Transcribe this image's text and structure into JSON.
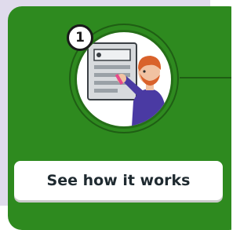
{
  "step": {
    "number": "1"
  },
  "illustration": {
    "icon": "technician-servicing-machine-illustration"
  },
  "cta": {
    "label": "See how it works"
  },
  "colors": {
    "card_background": "#2e8a1f",
    "ring": "#1f5e14",
    "page_background": "#e0dbec",
    "button_background": "#ffffff",
    "button_text": "#1f2a30"
  }
}
